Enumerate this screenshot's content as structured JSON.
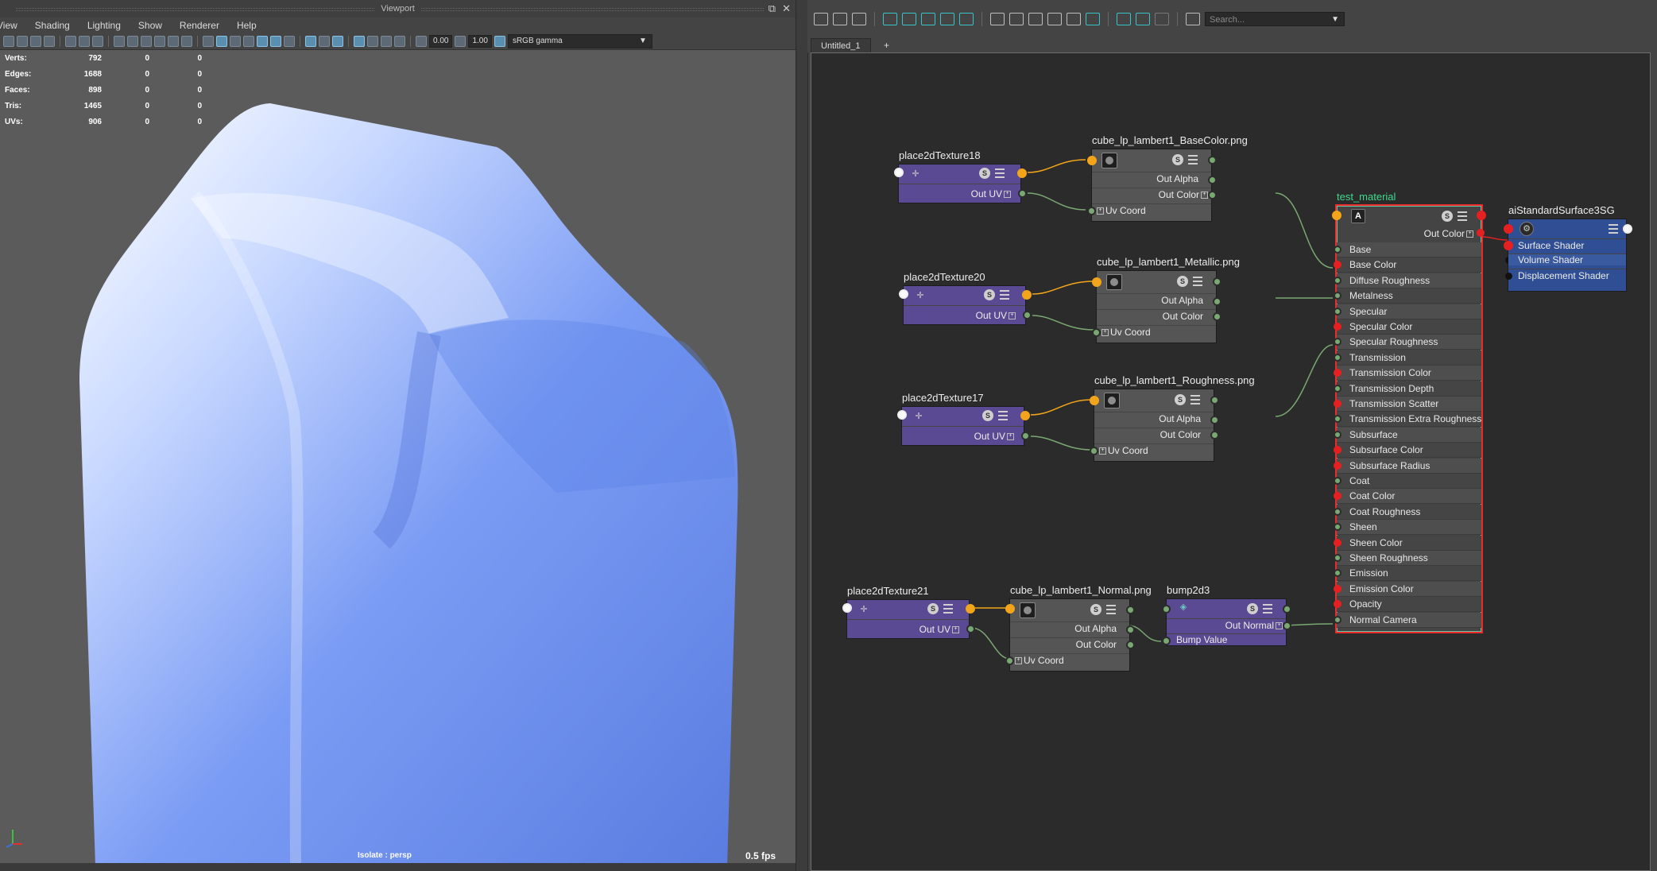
{
  "viewport": {
    "title": "Viewport",
    "menu": [
      "View",
      "Shading",
      "Lighting",
      "Show",
      "Renderer",
      "Help"
    ],
    "toolbar": {
      "field1": "0.00",
      "field2": "1.00",
      "colorspace": "sRGB gamma"
    },
    "hud": [
      {
        "label": "Verts:",
        "v1": "792",
        "v2": "0",
        "v3": "0"
      },
      {
        "label": "Edges:",
        "v1": "1688",
        "v2": "0",
        "v3": "0"
      },
      {
        "label": "Faces:",
        "v1": "898",
        "v2": "0",
        "v3": "0"
      },
      {
        "label": "Tris:",
        "v1": "1465",
        "v2": "0",
        "v3": "0"
      },
      {
        "label": "UVs:",
        "v1": "906",
        "v2": "0",
        "v3": "0"
      }
    ],
    "isolate": "Isolate : persp",
    "fps": "0.5 fps",
    "mesh_color": "#6f93f0"
  },
  "node_editor": {
    "search_placeholder": "Search...",
    "tab": "Untitled_1",
    "add_tab": "+",
    "nodes": {
      "p18": {
        "name": "place2dTexture18",
        "out": "Out UV"
      },
      "tex_base": {
        "name": "cube_lp_lambert1_BaseColor.png",
        "alpha": "Out Alpha",
        "color": "Out Color",
        "uv": "Uv Coord"
      },
      "p20": {
        "name": "place2dTexture20",
        "out": "Out UV"
      },
      "tex_metal": {
        "name": "cube_lp_lambert1_Metallic.png",
        "alpha": "Out Alpha",
        "color": "Out Color",
        "uv": "Uv Coord"
      },
      "p17": {
        "name": "place2dTexture17",
        "out": "Out UV"
      },
      "tex_rough": {
        "name": "cube_lp_lambert1_Roughness.png",
        "alpha": "Out Alpha",
        "color": "Out Color",
        "uv": "Uv Coord"
      },
      "p21": {
        "name": "place2dTexture21",
        "out": "Out UV"
      },
      "tex_normal": {
        "name": "cube_lp_lambert1_Normal.png",
        "alpha": "Out Alpha",
        "color": "Out Color",
        "uv": "Uv Coord"
      },
      "bump": {
        "name": "bump2d3",
        "out": "Out Normal",
        "in": "Bump Value"
      },
      "material": {
        "name": "test_material",
        "out": "Out Color",
        "attributes": [
          "Base",
          "Base Color",
          "Diffuse Roughness",
          "Metalness",
          "Specular",
          "Specular Color",
          "Specular Roughness",
          "Transmission",
          "Transmission Color",
          "Transmission Depth",
          "Transmission Scatter",
          "Transmission Extra Roughness",
          "Subsurface",
          "Subsurface Color",
          "Subsurface Radius",
          "Coat",
          "Coat Color",
          "Coat Roughness",
          "Sheen",
          "Sheen Color",
          "Sheen Roughness",
          "Emission",
          "Emission Color",
          "Opacity",
          "Normal Camera"
        ]
      },
      "sg": {
        "name": "aiStandardSurface3SG",
        "inputs": [
          "Surface Shader",
          "Volume Shader",
          "Displacement Shader"
        ]
      }
    },
    "colors": {
      "place2d": "#5a4a93",
      "texture": "#555555",
      "shading_group": "#2f4e93",
      "selection": "#ef2a2a",
      "material_label": "#3fd98f"
    }
  }
}
